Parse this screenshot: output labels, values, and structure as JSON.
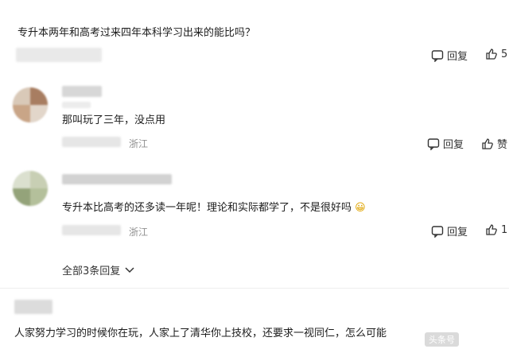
{
  "question": "专升本两年和高考过来四年本科学习出来的能比吗？",
  "comments": [
    {
      "text": "那叫玩了三年，没点用",
      "location": "浙江",
      "reply_label": "回复",
      "like_count": "赞"
    },
    {
      "text": "专升本比高考的还多读一年呢！理论和实际都学了，不是很好吗",
      "emoji": "😀",
      "location": "浙江",
      "reply_label": "回复",
      "like_count": "1"
    }
  ],
  "top_actions": {
    "reply_label": "回复",
    "like_count": "5"
  },
  "expand_replies": "全部3条回复",
  "last_comment": {
    "text": "人家努力学习的时候你在玩，人家上了清华你上技校，还要求一视同仁，怎么可能"
  },
  "watermark": "头条号",
  "colors": {
    "avatar1": "#b08566",
    "avatar2": "#9aa882",
    "meta": "#8f8f8f"
  }
}
